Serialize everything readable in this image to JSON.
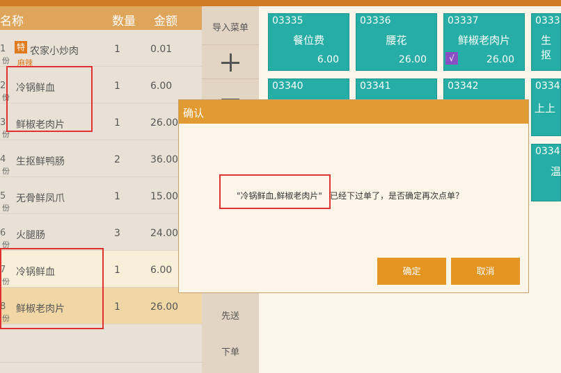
{
  "order": {
    "headers": {
      "name": "名称",
      "qty": "数量",
      "amount": "金额"
    },
    "unit": "份",
    "special_tag": "特",
    "rows": [
      {
        "idx": "1",
        "name": "农家小炒肉",
        "qty": "1",
        "amount": "0.01",
        "tag": "特",
        "note": "麻辣"
      },
      {
        "idx": "2",
        "name": "冷锅鲜血",
        "qty": "1",
        "amount": "6.00"
      },
      {
        "idx": "3",
        "name": "鲜椒老肉片",
        "qty": "1",
        "amount": "26.00"
      },
      {
        "idx": "4",
        "name": "生抠鲜鸭肠",
        "qty": "2",
        "amount": "36.00"
      },
      {
        "idx": "5",
        "name": "无骨鲜凤爪",
        "qty": "1",
        "amount": "15.00"
      },
      {
        "idx": "6",
        "name": "火腿肠",
        "qty": "3",
        "amount": "24.00"
      },
      {
        "idx": "7",
        "name": "冷锅鲜血",
        "qty": "1",
        "amount": "6.00"
      },
      {
        "idx": "8",
        "name": "鲜椒老肉片",
        "qty": "1",
        "amount": "26.00"
      }
    ]
  },
  "mid": {
    "import_menu": "导入菜单",
    "send_first": "先送",
    "place_order": "下单"
  },
  "dishes": [
    {
      "code": "03335",
      "name": "餐位费",
      "price": "6.00"
    },
    {
      "code": "03336",
      "name": "腰花",
      "price": "26.00"
    },
    {
      "code": "03337",
      "name": "鲜椒老肉片",
      "price": "26.00",
      "check": "√"
    },
    {
      "code": "0333",
      "name": "生抠"
    },
    {
      "code": "03340"
    },
    {
      "code": "03341"
    },
    {
      "code": "03342"
    },
    {
      "code": "0334",
      "name": "上上"
    },
    {
      "code": "0334",
      "name": "温"
    }
  ],
  "modal": {
    "title": "确认",
    "msg_quoted": "\"冷锅鲜血,鲜椒老肉片\"",
    "msg_rest": "已经下过单了，是否确定再次点单？",
    "ok": "确定",
    "cancel": "取消"
  }
}
